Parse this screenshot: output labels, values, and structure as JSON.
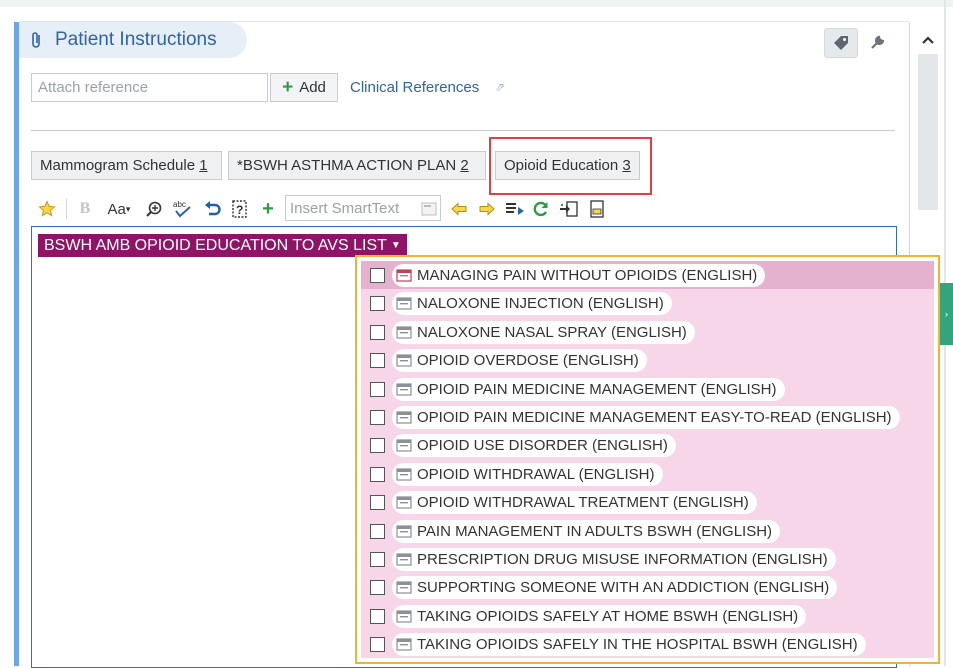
{
  "section": {
    "title": "Patient Instructions"
  },
  "reference": {
    "placeholder": "Attach reference",
    "add_label": "Add",
    "clinical_references": "Clinical References"
  },
  "tabs": [
    {
      "label": "Mammogram Schedule",
      "hotkey": "1"
    },
    {
      "label": "*BSWH ASTHMA ACTION PLAN",
      "hotkey": "2"
    },
    {
      "label": "Opioid Education",
      "hotkey": "3"
    }
  ],
  "toolbar": {
    "bold": "B",
    "font_size": "Aa",
    "smarttext_placeholder": "Insert SmartText"
  },
  "smartlist": {
    "label": "BSWH AMB OPIOID EDUCATION TO AVS LIST",
    "items": [
      "MANAGING PAIN WITHOUT OPIOIDS (ENGLISH)",
      "NALOXONE INJECTION (ENGLISH)",
      "NALOXONE NASAL SPRAY (ENGLISH)",
      "OPIOID OVERDOSE (ENGLISH)",
      "OPIOID PAIN MEDICINE MANAGEMENT (ENGLISH)",
      "OPIOID PAIN MEDICINE MANAGEMENT  EASY-TO-READ (ENGLISH)",
      "OPIOID USE DISORDER (ENGLISH)",
      "OPIOID WITHDRAWAL (ENGLISH)",
      "OPIOID WITHDRAWAL TREATMENT (ENGLISH)",
      "PAIN MANAGEMENT IN ADULTS BSWH (ENGLISH)",
      "PRESCRIPTION DRUG MISUSE INFORMATION (ENGLISH)",
      "SUPPORTING SOMEONE WITH AN ADDICTION (ENGLISH)",
      "TAKING OPIOIDS SAFELY AT HOME BSWH (ENGLISH)",
      "TAKING OPIOIDS SAFELY IN THE HOSPITAL BSWH (ENGLISH)"
    ]
  },
  "colors": {
    "accent_blue": "#2e64a8",
    "smartlist_purple": "#8f1466",
    "dropdown_pink": "#f7d6ea",
    "highlight_red": "#e04040",
    "dropdown_border_orange": "#f1b23a"
  },
  "icons": [
    "paperclip-icon",
    "tag-icon",
    "wrench-icon",
    "chevron-up-icon",
    "plus-icon",
    "external-link-icon",
    "star-icon",
    "zoom-icon",
    "spellcheck-icon",
    "undo-icon",
    "help-icon",
    "arrow-left-icon",
    "arrow-right-icon",
    "list-icon",
    "refresh-icon",
    "import-icon",
    "document-icon"
  ]
}
